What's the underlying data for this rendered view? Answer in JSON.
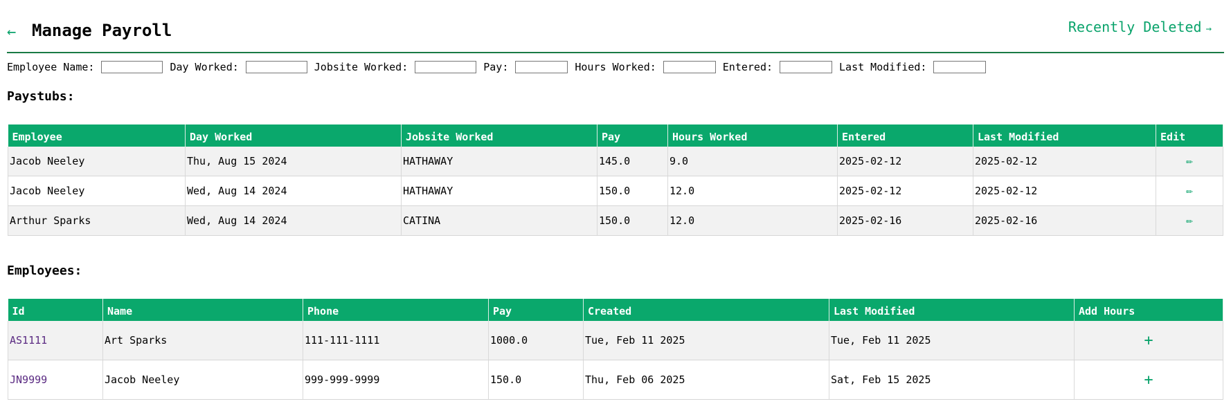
{
  "header": {
    "back_icon": "←",
    "title": "Manage Payroll",
    "recently_deleted_label": "Recently Deleted",
    "recently_deleted_arrow": "→"
  },
  "filters": [
    {
      "label": "Employee Name:"
    },
    {
      "label": "Day Worked:"
    },
    {
      "label": "Jobsite Worked:"
    },
    {
      "label": "Pay:"
    },
    {
      "label": "Hours Worked:"
    },
    {
      "label": "Entered:"
    },
    {
      "label": "Last Modified:"
    }
  ],
  "paystubs": {
    "title": "Paystubs:",
    "columns": [
      "Employee",
      "Day Worked",
      "Jobsite Worked",
      "Pay",
      "Hours Worked",
      "Entered",
      "Last Modified",
      "Edit"
    ],
    "rows": [
      {
        "employee": "Jacob Neeley",
        "day": "Thu, Aug 15 2024",
        "jobsite": "HATHAWAY",
        "pay": "145.0",
        "hours": "9.0",
        "entered": "2025-02-12",
        "modified": "2025-02-12",
        "edit_icon": "✏"
      },
      {
        "employee": "Jacob Neeley",
        "day": "Wed, Aug 14 2024",
        "jobsite": "HATHAWAY",
        "pay": "150.0",
        "hours": "12.0",
        "entered": "2025-02-12",
        "modified": "2025-02-12",
        "edit_icon": "✏"
      },
      {
        "employee": "Arthur Sparks",
        "day": "Wed, Aug 14 2024",
        "jobsite": "CATINA",
        "pay": "150.0",
        "hours": "12.0",
        "entered": "2025-02-16",
        "modified": "2025-02-16",
        "edit_icon": "✏"
      }
    ]
  },
  "employees": {
    "title": "Employees:",
    "columns": [
      "Id",
      "Name",
      "Phone",
      "Pay",
      "Created",
      "Last Modified",
      "Add Hours"
    ],
    "rows": [
      {
        "id": "AS1111",
        "name": "Art Sparks",
        "phone": "111-111-1111",
        "pay": "1000.0",
        "created": "Tue, Feb 11 2025",
        "modified": "Tue, Feb 11 2025",
        "add_icon": "+"
      },
      {
        "id": "JN9999",
        "name": "Jacob Neeley",
        "phone": "999-999-9999",
        "pay": "150.0",
        "created": "Thu, Feb 06 2025",
        "modified": "Sat, Feb 15 2025",
        "add_icon": "+"
      }
    ]
  },
  "colors": {
    "accent": "#0aa86c",
    "link": "#5a2a82",
    "row_alt": "#f2f2f2"
  }
}
